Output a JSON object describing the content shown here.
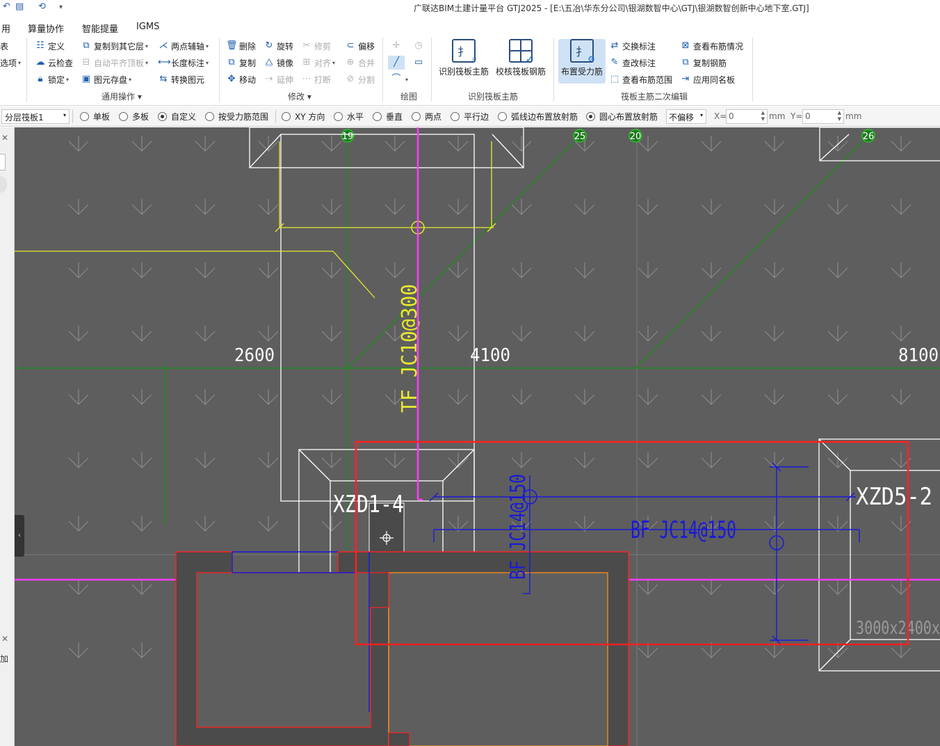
{
  "titlebar": {
    "title": "广联达BIM土建计量平台 GTJ2025 - [E:\\五冶\\华东分公司\\银湖数智中心\\GTJ\\银湖数智创新中心地下室.GTJ]"
  },
  "menubar": {
    "items": [
      "用",
      "算量协作",
      "智能提量",
      "IGMS"
    ]
  },
  "ribbon": {
    "left_partial": [
      "表",
      "选项"
    ],
    "general": {
      "col1": [
        "定义",
        "云检查",
        "锁定"
      ],
      "col2": [
        "复制到其它层",
        "自动平齐顶板",
        "图元存盘"
      ],
      "col3": [
        "两点辅轴",
        "长度标注",
        "转换图元"
      ],
      "group": "通用操作"
    },
    "modify": {
      "col1": [
        "删除",
        "复制",
        "移动"
      ],
      "col2": [
        "旋转",
        "镜像",
        "延伸"
      ],
      "col3": [
        "修剪",
        "对齐",
        "打断"
      ],
      "col4": [
        "偏移",
        "合并",
        "分割"
      ],
      "group": "修改"
    },
    "draw": {
      "group": "绘图"
    },
    "recognize": {
      "btn1": "识别筏板主筋",
      "btn2": "校核筏板钢筋",
      "group": "识别筏板主筋"
    },
    "edit2": {
      "big": "布置受力筋",
      "col1": [
        "交换标注",
        "查改标注",
        "查看布筋范围"
      ],
      "col2": [
        "查看布筋情况",
        "复制钢筋",
        "应用同名板"
      ],
      "group": "筏板主筋二次编辑"
    }
  },
  "optbar": {
    "layer": "分层筏板1",
    "radios": [
      "单板",
      "多板",
      "自定义",
      "按受力筋范围",
      "XY 方向",
      "水平",
      "垂直",
      "两点",
      "平行边",
      "弧线边布置放射筋",
      "圆心布置放射筋"
    ],
    "offset": "不偏移",
    "x_label": "X=",
    "x_value": "0",
    "y_label": "Y=",
    "y_value": "0",
    "unit": "mm"
  },
  "canvas": {
    "axis_labels": [
      "19",
      "25",
      "20",
      "26"
    ],
    "dims": [
      "2600",
      "4100",
      "8100"
    ],
    "annotations": {
      "tf": "TF JC10@300",
      "bf_h": "BF JC14@150",
      "bf_v": "BF JC14@150",
      "xzd1": "XZD1-4",
      "xzd5": "XZD5-2",
      "size": "3000x2400x"
    },
    "colors": {
      "background": "#5e5e5e",
      "magenta": "#ff3cff",
      "green": "#1f8a1f",
      "yellow": "#e8e830",
      "blue": "#1a1ad6",
      "red_highlight": "#ff2020"
    }
  }
}
